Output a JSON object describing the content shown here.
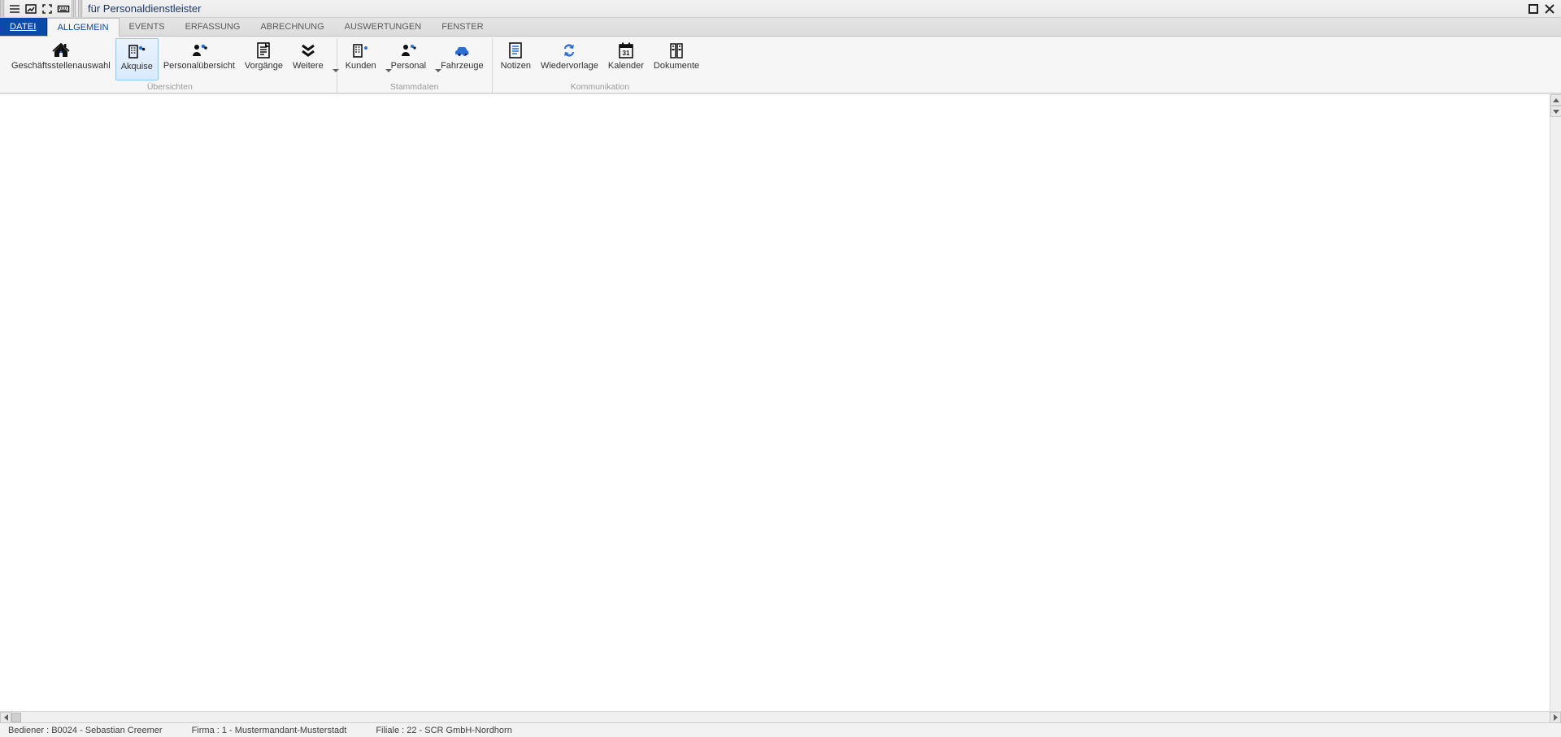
{
  "title": "für Personaldienstleister",
  "tabs": {
    "file": "DATEI",
    "items": [
      "ALLGEMEIN",
      "EVENTS",
      "ERFASSUNG",
      "ABRECHNUNG",
      "AUSWERTUNGEN",
      "FENSTER"
    ],
    "activeIndex": 0
  },
  "ribbon": {
    "groups": [
      {
        "caption": "Übersichten",
        "items": [
          {
            "id": "geschaeftsstellenauswahl",
            "label": "Geschäftsstellenauswahl",
            "icon": "home",
            "selected": false,
            "dropdown": false
          },
          {
            "id": "akquise",
            "label": "Akquise",
            "icon": "building-people",
            "selected": true,
            "dropdown": false
          },
          {
            "id": "personaluebersicht",
            "label": "Personalübersicht",
            "icon": "people",
            "selected": false,
            "dropdown": false
          },
          {
            "id": "vorgaenge",
            "label": "Vorgänge",
            "icon": "doc-lines",
            "selected": false,
            "dropdown": false
          },
          {
            "id": "weitere",
            "label": "Weitere",
            "icon": "chevrons-down",
            "selected": false,
            "dropdown": true
          }
        ]
      },
      {
        "caption": "Stammdaten",
        "items": [
          {
            "id": "kunden",
            "label": "Kunden",
            "icon": "building-plus",
            "selected": false,
            "dropdown": true
          },
          {
            "id": "personal",
            "label": "Personal",
            "icon": "people-plus",
            "selected": false,
            "dropdown": true
          },
          {
            "id": "fahrzeuge",
            "label": "Fahrzeuge",
            "icon": "car",
            "selected": false,
            "dropdown": false
          }
        ]
      },
      {
        "caption": "Kommunikation",
        "items": [
          {
            "id": "notizen",
            "label": "Notizen",
            "icon": "note",
            "selected": false,
            "dropdown": false
          },
          {
            "id": "wiedervorlage",
            "label": "Wiedervorlage",
            "icon": "cycle",
            "selected": false,
            "dropdown": false
          },
          {
            "id": "kalender",
            "label": "Kalender",
            "icon": "calendar",
            "selected": false,
            "dropdown": false
          },
          {
            "id": "dokumente",
            "label": "Dokumente",
            "icon": "binder",
            "selected": false,
            "dropdown": false
          }
        ]
      }
    ]
  },
  "statusbar": {
    "bediener_label": "Bediener  :",
    "bediener_value": "B0024 - Sebastian Creemer",
    "firma_label": "Firma :",
    "firma_value": "1 - Mustermandant-Musterstadt",
    "filiale_label": "Filiale  :",
    "filiale_value": "22 - SCR GmbH-Nordhorn"
  }
}
